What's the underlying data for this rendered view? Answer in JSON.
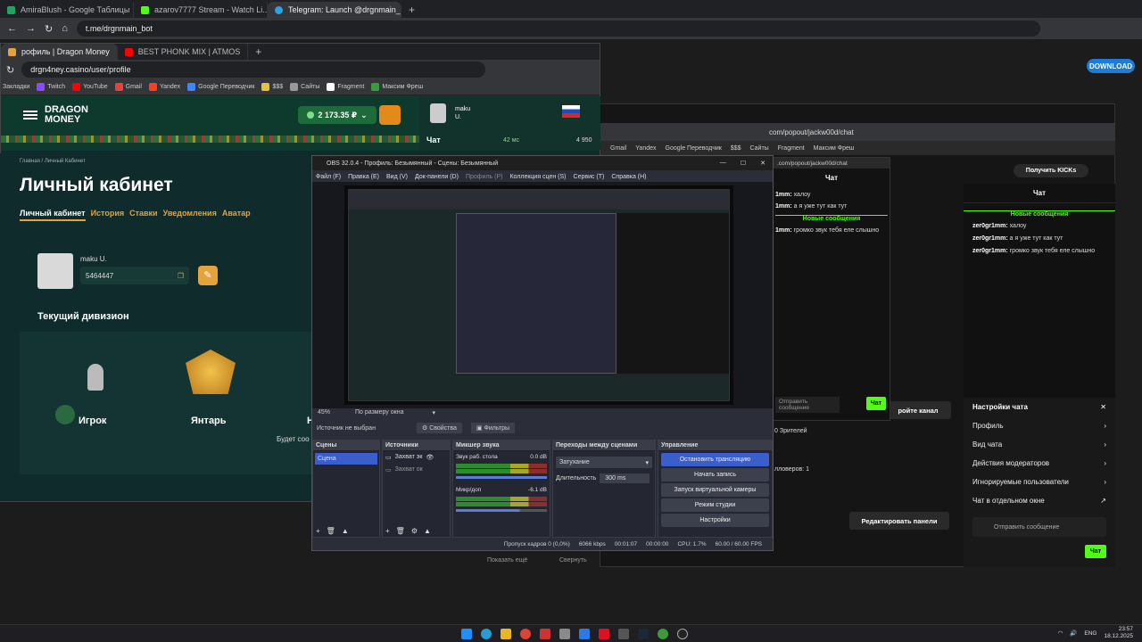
{
  "telegram": {
    "tabs": [
      {
        "label": "AmiraBlush - Google Таблицы",
        "color": "#1fa463"
      },
      {
        "label": "azarov7777 Stream - Watch Li...",
        "color": "#53fc18"
      },
      {
        "label": "Telegram: Launch @drgnmain_",
        "color": "#2aa3e0"
      }
    ],
    "url": "t.me/drgnmain_bot",
    "download_label": "DOWNLOAD"
  },
  "dragon": {
    "tabs": [
      {
        "label": "рофиль | Dragon Money",
        "color": "#e6a23c"
      },
      {
        "label": "BEST PHONK MIX | ATMOS",
        "color": "#ff0000"
      }
    ],
    "url": "drgn4ney.casino/user/profile",
    "bookmarks": [
      "Закладки",
      "Twitch",
      "YouTube",
      "Gmail",
      "Yandex",
      "Google Переводчик",
      "$$$",
      "Сайты",
      "Fragment",
      "Максим Фреш"
    ],
    "logo_line1": "DRAGON",
    "logo_line2": "MONEY",
    "balance": "2 173.35 ₽",
    "username_top": "maku U.",
    "chat_label": "Чат",
    "ping": "42 мс",
    "online": "4 950",
    "breadcrumb": "Главная / Личный Кабинет",
    "title": "Личный кабинет",
    "nav": [
      "Личный кабинет",
      "История",
      "Ставки",
      "Уведомления",
      "Аватар"
    ],
    "profile_name": "maku U.",
    "profile_id": "5464447",
    "division_title": "Текущий дивизион",
    "division_player": "Игрок",
    "division_rank": "Янтарь",
    "division_next": "Н",
    "division_hint": "Будет соо"
  },
  "kick": {
    "url": "com/popout/jackw00d/chat",
    "popup_url": ".com/popout/jackw00d/chat",
    "bookmarks": [
      "Gmail",
      "Yandex",
      "Google Переводчик",
      "$$$",
      "Сайты",
      "Fragment",
      "Максим Фреш"
    ],
    "get_kicks": "Получить KICKs",
    "chat_title": "Чат",
    "new_messages": "Новые сообщения",
    "messages": [
      {
        "user": "zer0gr1mm:",
        "text": " халоу"
      },
      {
        "user": "zer0gr1mm:",
        "text": " а я уже тут как тут"
      },
      {
        "user": "zer0gr1mm:",
        "text": " громко звук тебя еле слышно"
      }
    ],
    "popup_messages": [
      {
        "user": "1mm:",
        "text": " халоу"
      },
      {
        "user": "1mm:",
        "text": " а я уже тут как тут"
      },
      {
        "user": "1mm:",
        "text": " громко звук тебя еле слышно"
      }
    ],
    "settings_title": "Настройки чата",
    "settings": [
      "Профиль",
      "Вид чата",
      "Действия модераторов",
      "Игнорируемые пользователи",
      "Чат в отдельном окне"
    ],
    "send_placeholder": "Отправить сообщение",
    "chat_button": "Чат",
    "viewers": "0 Зрителей",
    "channel_btn": "ройте канал",
    "edit_panels": "Редактировать панели",
    "followers": "лловеров: 1"
  },
  "obs": {
    "title": "OBS 32.0.4 - Профиль: Безымянный - Сцены: Безымянный",
    "menu": [
      "Файл (F)",
      "Правка (E)",
      "Вид (V)",
      "Док-панели (D)",
      "Профиль (P)",
      "Коллекция сцен (S)",
      "Сервис (T)",
      "Справка (H)"
    ],
    "zoom": "45%",
    "fit": "По размеру окна",
    "no_source": "Источник не выбран",
    "props": "Свойства",
    "filters": "Фильтры",
    "scenes_h": "Сцены",
    "scene_item": "Сцена",
    "sources_h": "Источники",
    "sources": [
      "Захват эк",
      "Захват ок"
    ],
    "mixer_h": "Микшер звука",
    "mixer": [
      {
        "name": "Звук раб. стола",
        "db": "0.0 dB"
      },
      {
        "name": "Микр/доп",
        "db": "-6.1 dB"
      }
    ],
    "transitions_h": "Переходы между сценами",
    "transition": "Затухание",
    "duration_label": "Длительность",
    "duration": "300 ms",
    "controls_h": "Управление",
    "controls": [
      "Остановить трансляцию",
      "Начать запись",
      "Запуск виртуальной камеры",
      "Режим студии",
      "Настройки"
    ],
    "status": {
      "dropped": "Пропуск кадров 0 (0,0%)",
      "bitrate": "6066 kbps",
      "live": "00:01:07",
      "rec": "00:00:00",
      "cpu": "CPU: 1.7%",
      "fps": "60.00 / 60.00 FPS"
    },
    "below_left": "Показать ещё",
    "below_right": "Свернуть"
  },
  "taskbar": {
    "lang": "ENG",
    "time": "23:57",
    "date": "18.12.2025"
  }
}
